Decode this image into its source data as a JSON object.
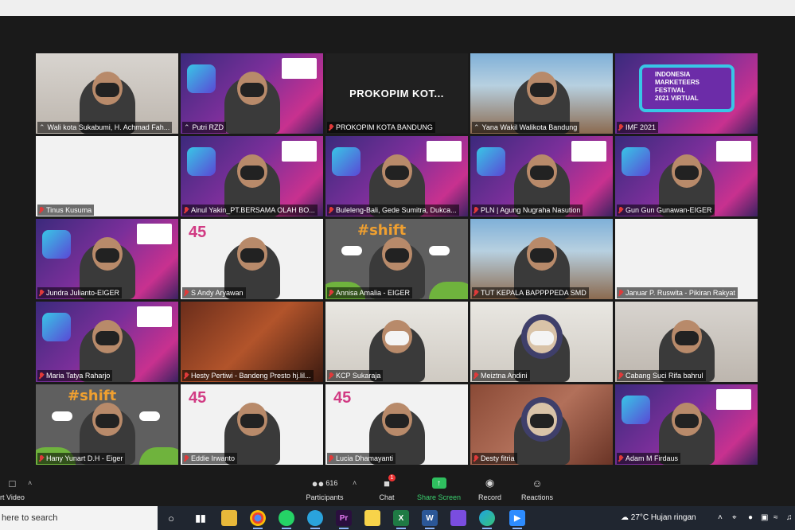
{
  "meeting": {
    "participants": [
      {
        "name": "Wali kota Sukabumi, H. Achmad Fah...",
        "style": "office",
        "active": true,
        "muted": false
      },
      {
        "name": "Putri RZD",
        "style": "purple",
        "muted": false
      },
      {
        "name": "PROKOPIM KOTA BANDUNG",
        "style": "dark",
        "muted": true,
        "center_text": "PROKOPIM KOT..."
      },
      {
        "name": "Yana Wakil Walikota Bandung",
        "style": "photo",
        "muted": false
      },
      {
        "name": "IMF 2021",
        "style": "imf",
        "muted": true,
        "imf_lines": [
          "INDONESIA",
          "MARKETEERS",
          "FESTIVAL",
          "2021 VIRTUAL"
        ]
      },
      {
        "name": "Tinus Kusuma",
        "style": "white",
        "muted": true
      },
      {
        "name": "Ainul Yakin_PT.BERSAMA OLAH BO...",
        "style": "purple",
        "muted": true
      },
      {
        "name": "Buleleng-Bali, Gede Sumitra, Dukca...",
        "style": "purple",
        "muted": true
      },
      {
        "name": "PLN | Agung Nugraha Nasution",
        "style": "purple",
        "muted": true
      },
      {
        "name": "Gun Gun Gunawan-EIGER",
        "style": "purple",
        "muted": true
      },
      {
        "name": "Jundra Julianto-EIGER",
        "style": "purple",
        "muted": true
      },
      {
        "name": "S Andy Aryawan",
        "style": "fortyfive",
        "muted": true
      },
      {
        "name": "Annisa Amalia - EIGER",
        "style": "shift",
        "muted": true
      },
      {
        "name": "TUT KEPALA BAPPPPEDA SMD",
        "style": "photo",
        "muted": true
      },
      {
        "name": "Januar P. Ruswita - Pikiran Rakyat",
        "style": "white",
        "muted": true
      },
      {
        "name": "Maria Tatya Raharjo",
        "style": "purple",
        "muted": true
      },
      {
        "name": "Hesty Pertiwi - Bandeng Presto hj.lil...",
        "style": "food",
        "muted": true
      },
      {
        "name": "KCP Sukaraja",
        "style": "room",
        "muted": true
      },
      {
        "name": "Meiztna Andini",
        "style": "room",
        "muted": true
      },
      {
        "name": "Cabang Suci Rifa bahrul",
        "style": "office",
        "muted": true
      },
      {
        "name": "Hany Yunart D.H - Eiger",
        "style": "shift",
        "muted": true
      },
      {
        "name": "Eddie Irwanto",
        "style": "fortyfive",
        "muted": true
      },
      {
        "name": "Lucia Dhamayanti",
        "style": "fortyfive",
        "muted": true
      },
      {
        "name": "Desty fitria",
        "style": "brick",
        "muted": true
      },
      {
        "name": "Adam M Firdaus",
        "style": "purple",
        "muted": true
      }
    ]
  },
  "controls": {
    "video_label": "rt Video",
    "participants_label": "Participants",
    "participants_count": "616",
    "chat_label": "Chat",
    "chat_badge": "1",
    "share_label": "Share Screen",
    "record_label": "Record",
    "reactions_label": "Reactions"
  },
  "taskbar": {
    "search_placeholder": "here to search",
    "weather": "27°C  Hujan ringan",
    "apps": [
      "Task View",
      "File Explorer",
      "Chrome",
      "WhatsApp",
      "Telegram",
      "Premiere",
      "Notes",
      "Excel",
      "Word",
      "Edge",
      "Zoom"
    ]
  }
}
